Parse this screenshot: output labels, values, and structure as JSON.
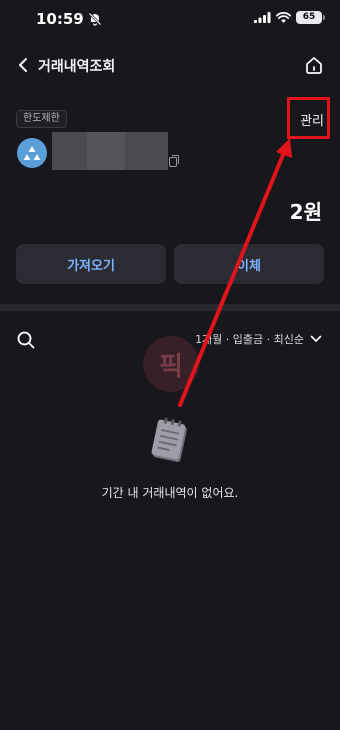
{
  "status_bar": {
    "time": "10:59",
    "battery": "65"
  },
  "nav": {
    "title": "거래내역조회"
  },
  "account": {
    "limit_chip": "한도제한",
    "manage_label": "관리",
    "balance": "2원"
  },
  "actions": {
    "import_label": "가져오기",
    "transfer_label": "이체"
  },
  "filter": {
    "label": "1개월 · 입출금 · 최신순"
  },
  "watermark": {
    "text": "픽"
  },
  "empty_state": {
    "message": "기간 내 거래내역이 없어요."
  },
  "colors": {
    "background": "#17171c",
    "button_bg": "#2b2c33",
    "accent_text": "#7eb2ff",
    "annotation_red": "#e2141b",
    "bank_logo": "#5a9fd8"
  },
  "icons": [
    "bell-off-icon",
    "signal-icon",
    "wifi-icon",
    "battery-icon",
    "back-arrow-icon",
    "home-icon",
    "bank-logo-icon",
    "copy-icon",
    "search-icon",
    "chevron-down-icon",
    "empty-note-icon"
  ]
}
